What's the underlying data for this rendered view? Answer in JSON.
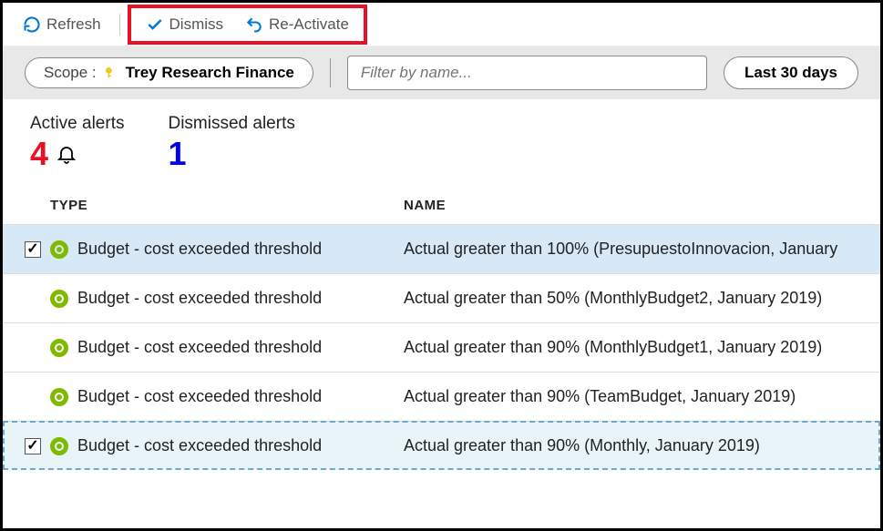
{
  "toolbar": {
    "refresh_label": "Refresh",
    "dismiss_label": "Dismiss",
    "reactivate_label": "Re-Activate"
  },
  "filterbar": {
    "scope_label": "Scope :",
    "scope_value": "Trey Research Finance",
    "filter_placeholder": "Filter by name...",
    "days_label": "Last 30 days"
  },
  "stats": {
    "active_label": "Active alerts",
    "active_count": "4",
    "dismissed_label": "Dismissed alerts",
    "dismissed_count": "1"
  },
  "table": {
    "type_header": "TYPE",
    "name_header": "NAME",
    "rows": [
      {
        "checked": true,
        "type": "Budget - cost exceeded threshold",
        "name": "Actual greater than 100% (PresupuestoInnovacion, January "
      },
      {
        "checked": false,
        "type": "Budget - cost exceeded threshold",
        "name": "Actual greater than 50% (MonthlyBudget2, January 2019)"
      },
      {
        "checked": false,
        "type": "Budget - cost exceeded threshold",
        "name": "Actual greater than 90% (MonthlyBudget1, January 2019)"
      },
      {
        "checked": false,
        "type": "Budget - cost exceeded threshold",
        "name": "Actual greater than 90% (TeamBudget, January 2019)"
      },
      {
        "checked": true,
        "type": "Budget - cost exceeded threshold",
        "name": "Actual greater than 90% (Monthly, January 2019)"
      }
    ]
  }
}
